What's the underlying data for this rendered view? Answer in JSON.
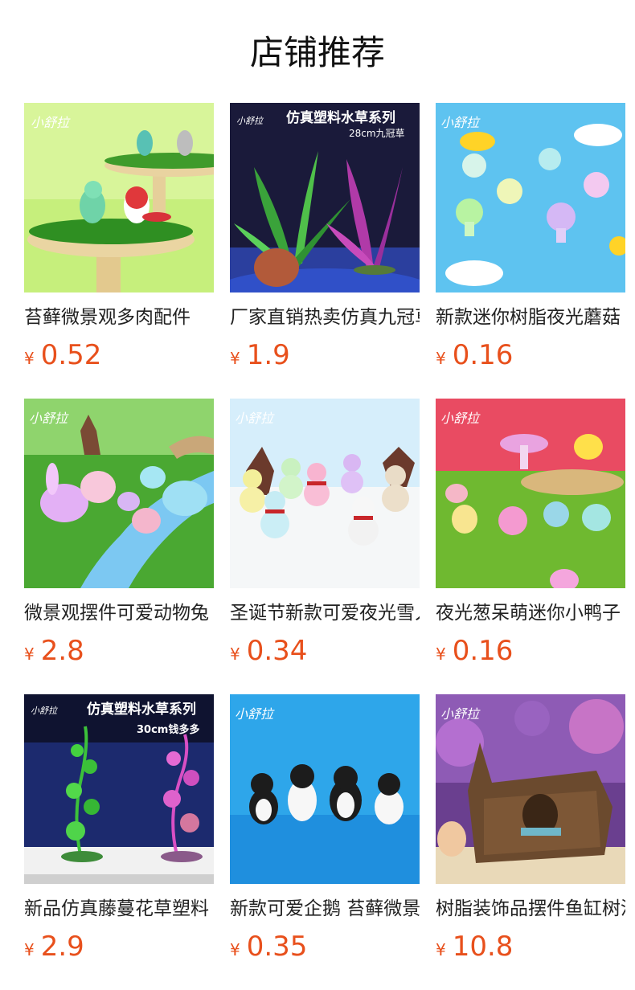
{
  "section": {
    "title": "店铺推荐"
  },
  "colors": {
    "price": "#e8501c",
    "title": "#111111",
    "name": "#222222"
  },
  "products": [
    {
      "name": "苔藓微景观多肉配件",
      "currency": "¥",
      "price": "0.52",
      "image_icon": "bird-figurine-image",
      "overlay_title": "",
      "overlay_sub": ""
    },
    {
      "name": "厂家直销热卖仿真九冠草",
      "currency": "¥",
      "price": "1.9",
      "image_icon": "aquarium-plant-image",
      "overlay_title": "仿真塑料水草系列",
      "overlay_sub": "28cm九冠草"
    },
    {
      "name": "新款迷你树脂夜光蘑菇",
      "currency": "¥",
      "price": "0.16",
      "image_icon": "glow-mushroom-image",
      "overlay_title": "",
      "overlay_sub": ""
    },
    {
      "name": "微景观摆件可爱动物兔",
      "currency": "¥",
      "price": "2.8",
      "image_icon": "rabbit-figurine-image",
      "overlay_title": "",
      "overlay_sub": ""
    },
    {
      "name": "圣诞节新款可爱夜光雪人",
      "currency": "¥",
      "price": "0.34",
      "image_icon": "snowman-figurine-image",
      "overlay_title": "",
      "overlay_sub": ""
    },
    {
      "name": "夜光葱呆萌迷你小鸭子",
      "currency": "¥",
      "price": "0.16",
      "image_icon": "duck-figurine-image",
      "overlay_title": "",
      "overlay_sub": ""
    },
    {
      "name": "新品仿真藤蔓花草塑料",
      "currency": "¥",
      "price": "2.9",
      "image_icon": "vine-plant-image",
      "overlay_title": "仿真塑料水草系列",
      "overlay_sub": "30cm钱多多"
    },
    {
      "name": "新款可爱企鹅 苔藓微景观",
      "currency": "¥",
      "price": "0.35",
      "image_icon": "penguin-figurine-image",
      "overlay_title": "",
      "overlay_sub": ""
    },
    {
      "name": "树脂装饰品摆件鱼缸树洞",
      "currency": "¥",
      "price": "10.8",
      "image_icon": "tree-trunk-ornament-image",
      "overlay_title": "",
      "overlay_sub": ""
    }
  ]
}
